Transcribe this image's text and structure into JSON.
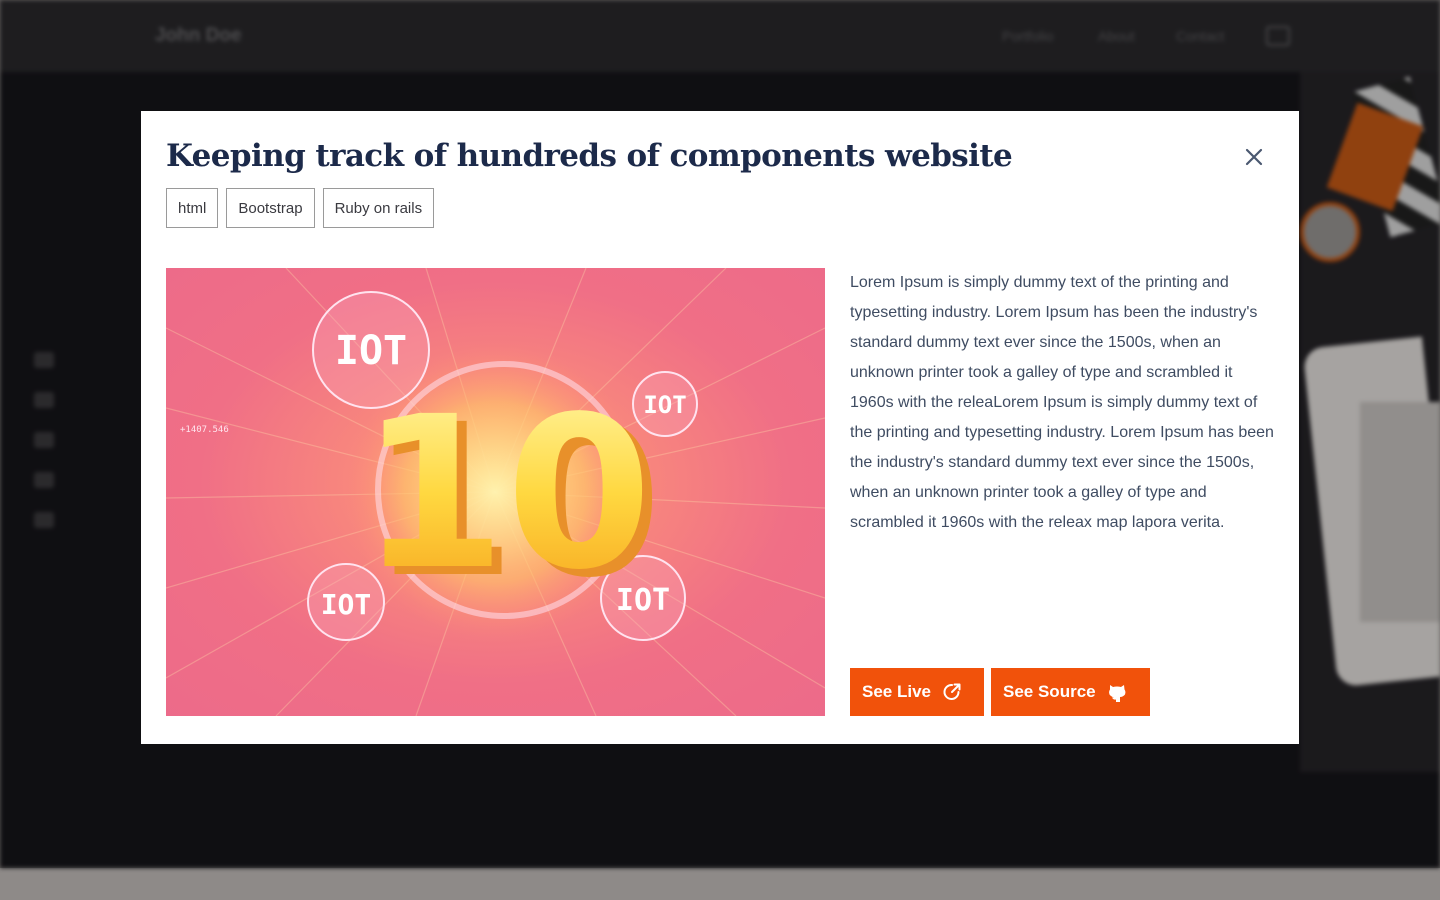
{
  "background": {
    "logo": "John Doe",
    "nav": [
      "Portfolio",
      "About",
      "Contact"
    ],
    "nav_icon": "calendar-icon",
    "socials": [
      "angellist-icon",
      "linkedin-icon",
      "pinterest-icon",
      "twitter-icon",
      "medium-icon"
    ]
  },
  "modal": {
    "title": "Keeping track of hundreds  of components website",
    "close_icon": "close-icon",
    "tags": [
      "html",
      "Bootstrap",
      "Ruby on rails"
    ],
    "image": {
      "main_text": "10",
      "badge_text": "IOT",
      "small_readout": "+1407.546"
    },
    "description": "Lorem Ipsum is simply dummy text of the printing and typesetting industry. Lorem Ipsum has been the industry's standard dummy text ever since the 1500s, when an unknown printer took a galley of type and scrambled it 1960s with the releaLorem Ipsum is simply dummy text of the printing and typesetting industry. Lorem Ipsum has been the industry's standard dummy text ever since the 1500s, when an unknown printer took a galley of type and scrambled it 1960s with the releax map lapora verita.",
    "buttons": {
      "live_label": "See Live",
      "live_icon": "external-link-icon",
      "source_label": "See Source",
      "source_icon": "github-icon"
    }
  },
  "colors": {
    "accent": "#f1520b",
    "title": "#1c2a4a",
    "text": "#3f4c62",
    "overlay_bg": "#16151a"
  }
}
